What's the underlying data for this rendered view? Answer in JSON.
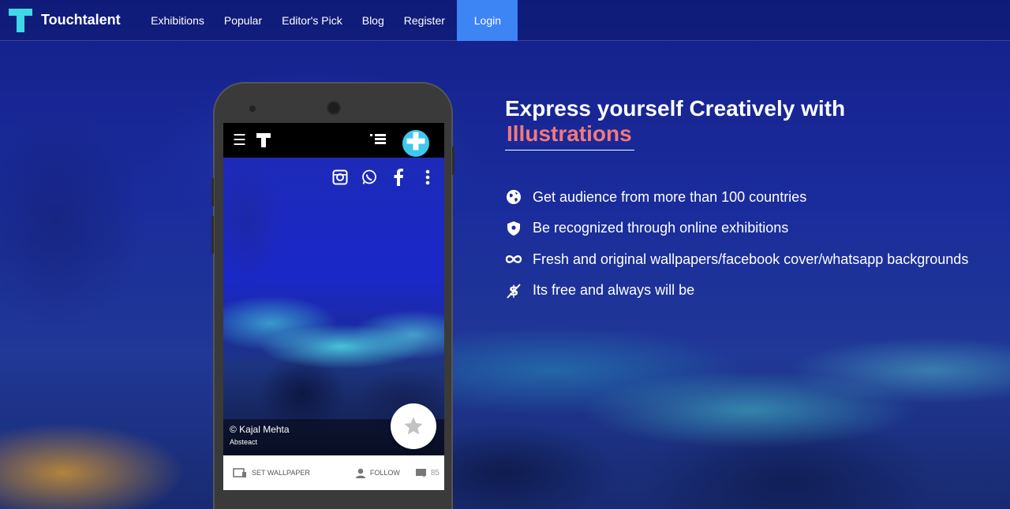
{
  "nav": {
    "brand": "Touchtalent",
    "links": [
      "Exhibitions",
      "Popular",
      "Editor's Pick",
      "Blog",
      "Register"
    ],
    "login": "Login",
    "login_color": "#3d84f5"
  },
  "phone": {
    "artwork": {
      "author": "© Kajal Mehta",
      "category": "Absteact"
    },
    "bottom_bar": {
      "set_wallpaper": "SET WALLPAPER",
      "follow": "FOLLOW",
      "comments": "85"
    }
  },
  "hero": {
    "title": "Express yourself Creatively with",
    "highlight": "Illustrations",
    "highlight_color": "#f5787b",
    "features": [
      {
        "icon": "globe-icon",
        "text": "Get audience from more than 100 countries"
      },
      {
        "icon": "shield-icon",
        "text": "Be recognized through online exhibitions"
      },
      {
        "icon": "infinity-icon",
        "text": "Fresh and original wallpapers/facebook cover/whatsapp backgrounds"
      },
      {
        "icon": "no-dollar-icon",
        "text": "Its free and always will be"
      }
    ]
  }
}
